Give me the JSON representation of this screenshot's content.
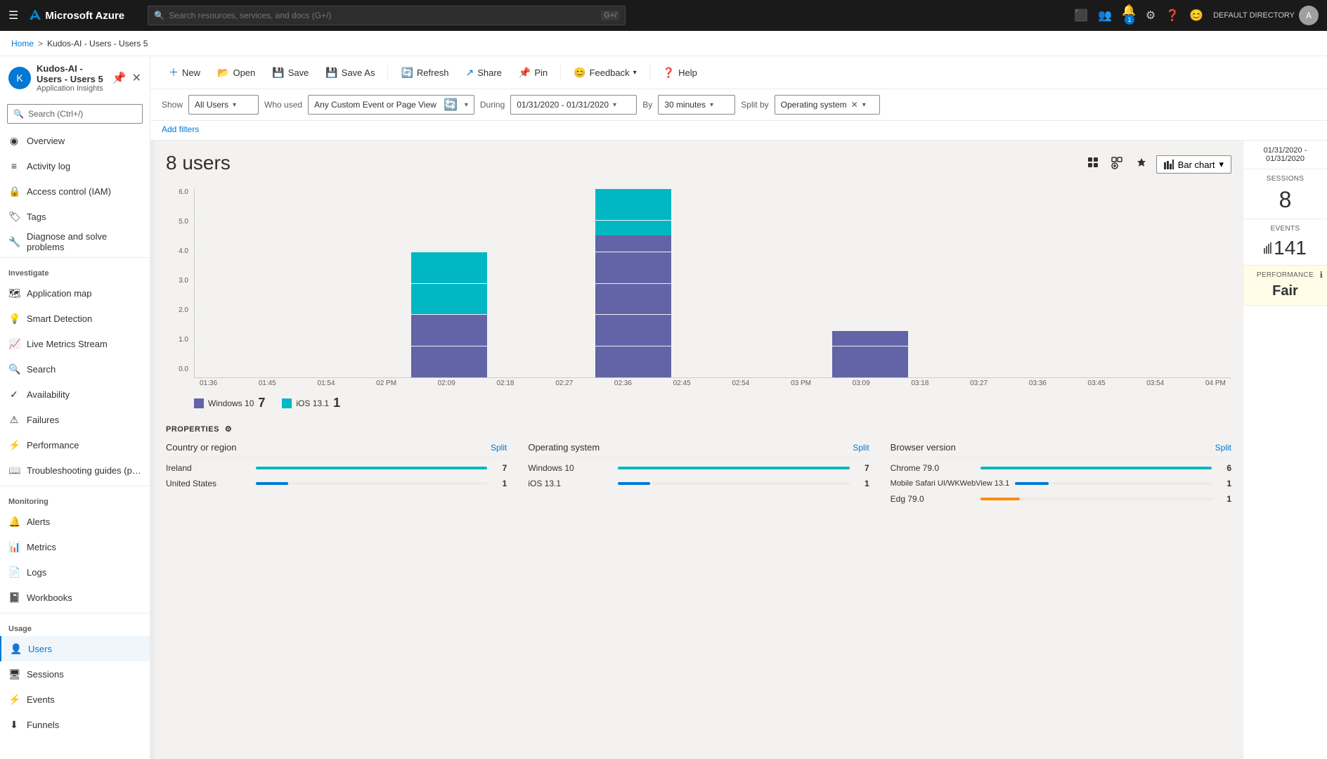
{
  "topnav": {
    "hamburger": "☰",
    "logo": "Microsoft Azure",
    "search_placeholder": "Search resources, services, and docs (G+/)",
    "notification_count": "1",
    "user_label": "DEFAULT DIRECTORY"
  },
  "breadcrumb": {
    "home": "Home",
    "separator": ">",
    "current": "Kudos-AI - Users - Users 5"
  },
  "sidebar": {
    "app_name": "Kudos-AI - Users - Users 5",
    "app_subtitle": "Application Insights",
    "search_placeholder": "Search (Ctrl+/)",
    "nav_items": [
      {
        "id": "overview",
        "label": "Overview",
        "icon": "◉"
      },
      {
        "id": "activity-log",
        "label": "Activity log",
        "icon": "📋"
      },
      {
        "id": "access-control",
        "label": "Access control (IAM)",
        "icon": "🔒"
      },
      {
        "id": "tags",
        "label": "Tags",
        "icon": "🏷"
      },
      {
        "id": "diagnose",
        "label": "Diagnose and solve problems",
        "icon": "🔧"
      }
    ],
    "investigate_label": "Investigate",
    "investigate_items": [
      {
        "id": "app-map",
        "label": "Application map",
        "icon": "🗺"
      },
      {
        "id": "smart-detection",
        "label": "Smart Detection",
        "icon": "💡"
      },
      {
        "id": "live-metrics",
        "label": "Live Metrics Stream",
        "icon": "📈"
      },
      {
        "id": "search",
        "label": "Search",
        "icon": "🔍"
      },
      {
        "id": "availability",
        "label": "Availability",
        "icon": "✅"
      },
      {
        "id": "failures",
        "label": "Failures",
        "icon": "⚠"
      },
      {
        "id": "performance",
        "label": "Performance",
        "icon": "⚡"
      },
      {
        "id": "troubleshooting",
        "label": "Troubleshooting guides (pre...",
        "icon": "📖"
      }
    ],
    "monitoring_label": "Monitoring",
    "monitoring_items": [
      {
        "id": "alerts",
        "label": "Alerts",
        "icon": "🔔"
      },
      {
        "id": "metrics",
        "label": "Metrics",
        "icon": "📊"
      },
      {
        "id": "logs",
        "label": "Logs",
        "icon": "📄"
      },
      {
        "id": "workbooks",
        "label": "Workbooks",
        "icon": "📓"
      }
    ],
    "usage_label": "Usage",
    "usage_items": [
      {
        "id": "users",
        "label": "Users",
        "icon": "👤",
        "active": true
      },
      {
        "id": "sessions",
        "label": "Sessions",
        "icon": "🖥"
      },
      {
        "id": "events",
        "label": "Events",
        "icon": "⚡"
      },
      {
        "id": "funnels",
        "label": "Funnels",
        "icon": "⬇"
      }
    ]
  },
  "toolbar": {
    "new_label": "New",
    "open_label": "Open",
    "save_label": "Save",
    "saveas_label": "Save As",
    "refresh_label": "Refresh",
    "share_label": "Share",
    "pin_label": "Pin",
    "feedback_label": "Feedback",
    "help_label": "Help"
  },
  "filters": {
    "show_label": "Show",
    "show_value": "All Users",
    "who_used_label": "Who used",
    "who_used_value": "Any Custom Event or Page View",
    "during_label": "During",
    "during_value": "01/31/2020 - 01/31/2020",
    "by_label": "By",
    "by_value": "30 minutes",
    "split_label": "Split by",
    "split_value": "Operating system",
    "add_filters": "Add filters"
  },
  "chart": {
    "title": "8 users",
    "type_label": "Bar chart",
    "date_range": "01/31/2020 - 01/31/2020",
    "y_axis": [
      "6.0",
      "5.0",
      "4.0",
      "3.0",
      "2.0",
      "1.0",
      "0.0"
    ],
    "x_labels": [
      "01:36",
      "01:45",
      "01:54",
      "02 PM",
      "02:09",
      "02:18",
      "02:27",
      "02:36",
      "02:45",
      "02:54",
      "03 PM",
      "03:09",
      "03:18",
      "03:27",
      "03:36",
      "03:45",
      "03:54",
      "04 PM"
    ],
    "bars": [
      {
        "cyan": 0,
        "purple": 0
      },
      {
        "cyan": 0,
        "purple": 0
      },
      {
        "cyan": 0,
        "purple": 0
      },
      {
        "cyan": 0,
        "purple": 0
      },
      {
        "cyan": 2,
        "purple": 2
      },
      {
        "cyan": 0,
        "purple": 0
      },
      {
        "cyan": 0,
        "purple": 0
      },
      {
        "cyan": 1.5,
        "purple": 4.5
      },
      {
        "cyan": 0,
        "purple": 0
      },
      {
        "cyan": 0,
        "purple": 0
      },
      {
        "cyan": 0,
        "purple": 0
      },
      {
        "cyan": 0,
        "purple": 1.5
      },
      {
        "cyan": 0,
        "purple": 0
      },
      {
        "cyan": 0,
        "purple": 0
      },
      {
        "cyan": 0,
        "purple": 0
      },
      {
        "cyan": 0,
        "purple": 0
      },
      {
        "cyan": 0,
        "purple": 0
      },
      {
        "cyan": 0,
        "purple": 0
      }
    ],
    "legend": [
      {
        "id": "win10",
        "color": "#6264a7",
        "label": "Windows 10",
        "value": "7"
      },
      {
        "id": "ios",
        "color": "#00b7c3",
        "label": "iOS 13.1",
        "value": "1"
      }
    ]
  },
  "stats": {
    "sessions_label": "SESSIONS",
    "sessions_value": "8",
    "events_label": "EVENTS",
    "events_value": "141",
    "performance_label": "PERFORMANCE",
    "performance_value": "Fair"
  },
  "properties": {
    "title": "PROPERTIES",
    "columns": [
      {
        "title": "Country or region",
        "split_label": "Split",
        "rows": [
          {
            "name": "Ireland",
            "value": "7",
            "bar_pct": 100,
            "bar_color": "#00b7c3"
          },
          {
            "name": "United States",
            "value": "1",
            "bar_pct": 14,
            "bar_color": "#0078d4"
          }
        ]
      },
      {
        "title": "Operating system",
        "split_label": "Split",
        "rows": [
          {
            "name": "Windows 10",
            "value": "7",
            "bar_pct": 100,
            "bar_color": "#00b7c3"
          },
          {
            "name": "iOS 13.1",
            "value": "1",
            "bar_pct": 14,
            "bar_color": "#0078d4"
          }
        ]
      },
      {
        "title": "Browser version",
        "split_label": "Split",
        "rows": [
          {
            "name": "Chrome 79.0",
            "value": "6",
            "bar_pct": 86,
            "bar_color": "#00b7c3"
          },
          {
            "name": "Mobile Safari UI/WKWebView 13.1",
            "value": "1",
            "bar_pct": 14,
            "bar_color": "#0078d4"
          },
          {
            "name": "Edg 79.0",
            "value": "1",
            "bar_pct": 14,
            "bar_color": "#ff8c00"
          }
        ]
      }
    ]
  }
}
